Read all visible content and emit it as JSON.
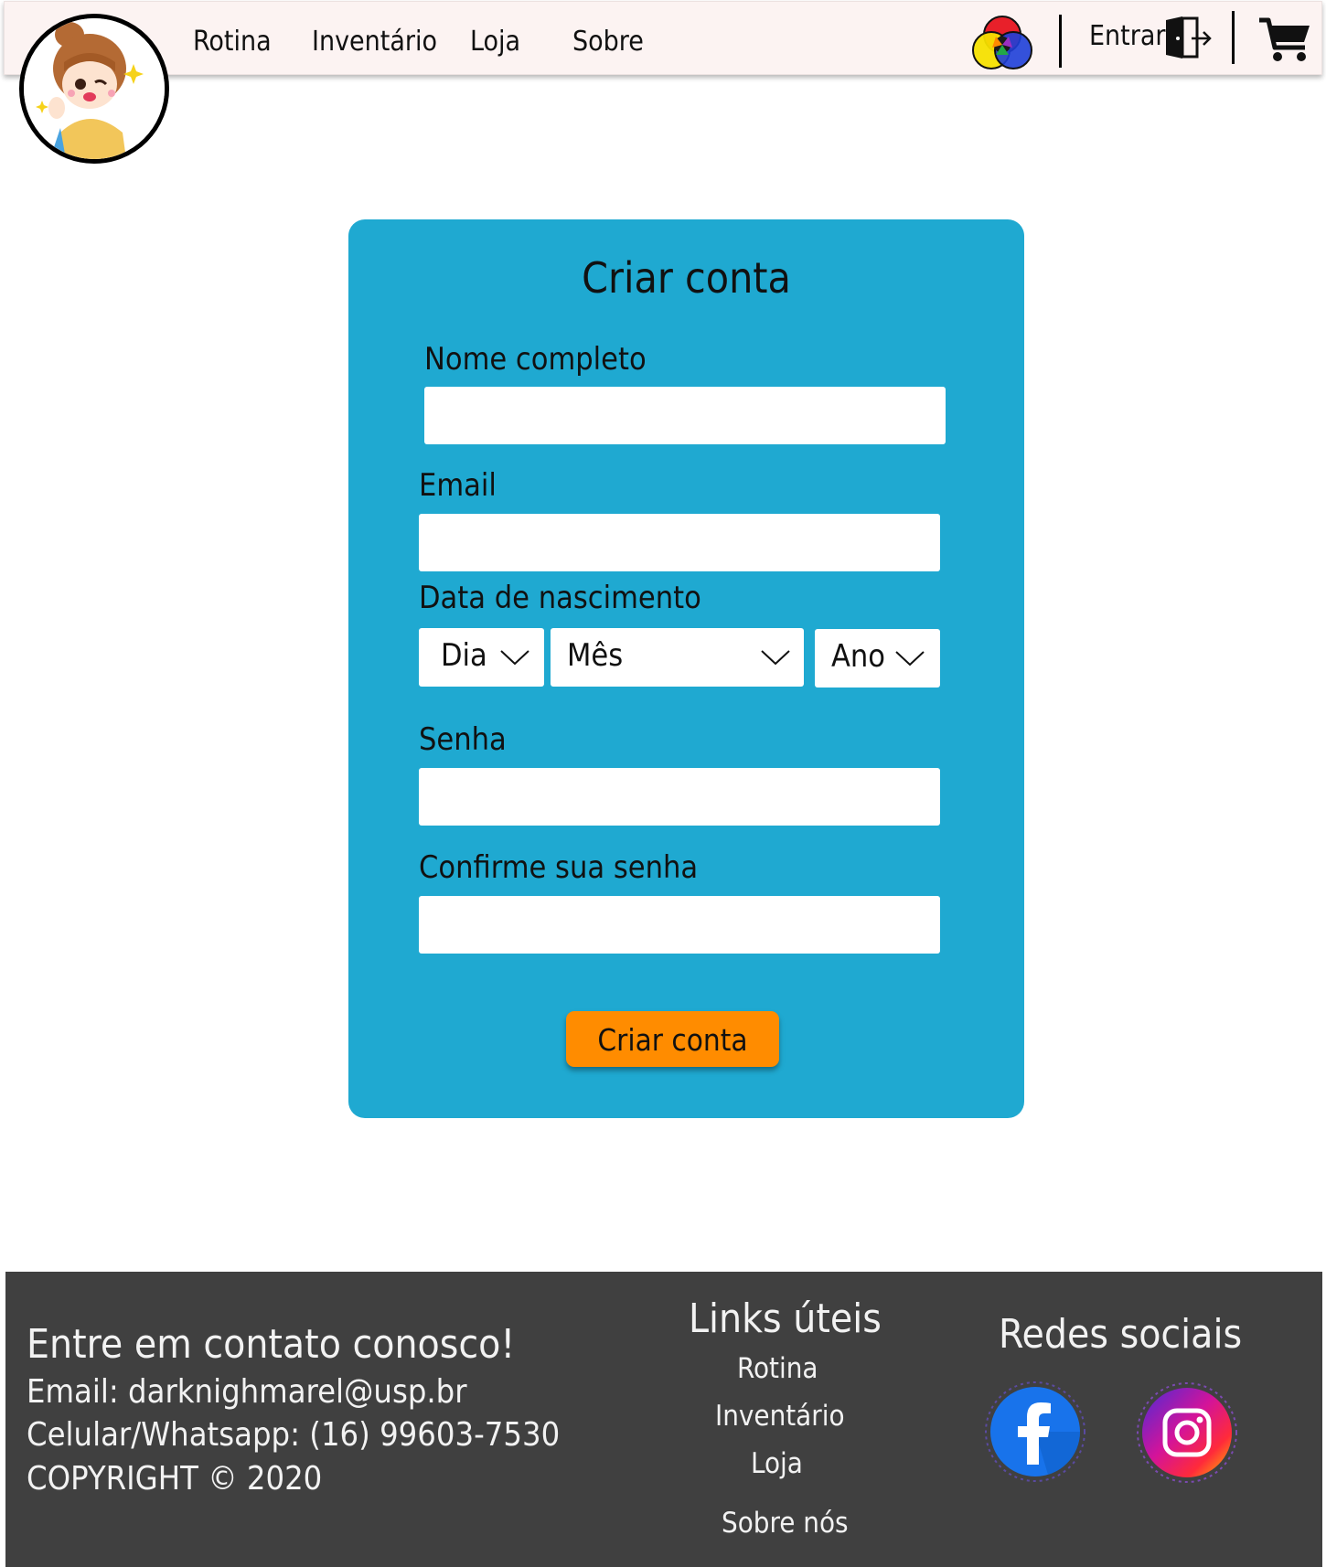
{
  "header": {
    "nav": [
      "Rotina",
      "Inventário",
      "Loja",
      "Sobre"
    ],
    "login_label": "Entrar",
    "icons": {
      "logo": "cartoon-girl-logo",
      "accessibility": "color-wheel-icon",
      "login": "door-exit-icon",
      "cart": "shopping-cart-icon"
    }
  },
  "form": {
    "title": "Criar conta",
    "fields": {
      "nome_label": "Nome completo",
      "nome_value": "",
      "email_label": "Email",
      "email_value": "",
      "nascimento_label": "Data de nascimento",
      "dia": "Dia",
      "mes": "Mês",
      "ano": "Ano",
      "senha_label": "Senha",
      "senha_value": "",
      "confirme_label": "Confirme sua senha",
      "confirme_value": ""
    },
    "submit_label": "Criar conta"
  },
  "footer": {
    "contact": {
      "title": "Entre em contato conosco!",
      "email": "Email: darknighmarel@usp.br",
      "phone": "Celular/Whatsapp: (16) 99603-7530",
      "copyright": "COPYRIGHT © 2020"
    },
    "links": {
      "title": "Links úteis",
      "items": [
        "Rotina",
        "Inventário",
        "Loja",
        "Sobre nós"
      ]
    },
    "social": {
      "title": "Redes sociais",
      "icons": [
        "facebook-icon",
        "instagram-icon"
      ]
    }
  },
  "colors": {
    "header_bg": "#fcf3f2",
    "card_bg": "#1fa9d1",
    "button": "#ff8c00",
    "footer_bg": "#404040"
  }
}
